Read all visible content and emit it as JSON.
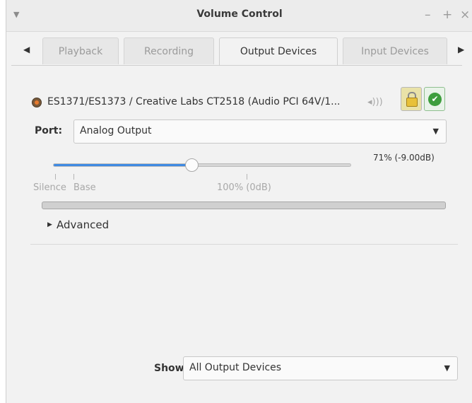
{
  "window": {
    "title": "Volume Control",
    "controls": [
      "minimize-icon",
      "maximize-icon",
      "close-icon"
    ]
  },
  "tabs": [
    {
      "label": "Playback",
      "active": false
    },
    {
      "label": "Recording",
      "active": false
    },
    {
      "label": "Output Devices",
      "active": true
    },
    {
      "label": "Input Devices",
      "active": false
    }
  ],
  "device": {
    "name": "ES1371/ES1373 / Creative Labs CT2518 (Audio PCI 64V/1...",
    "mute_icon": "speaker-icon",
    "lock_icon": "padlock-icon",
    "default_icon": "checkmark-icon",
    "port_label": "Port:",
    "port_value": "Analog Output",
    "volume_text": "71% (-9.00dB)",
    "volume_fraction": 0.71,
    "scale_marks": [
      "Silence",
      "Base",
      "100% (0dB)"
    ],
    "advanced_label": "Advanced"
  },
  "footer": {
    "show_label": "Show:",
    "show_value": "All Output Devices"
  },
  "colors": {
    "accent": "#3f8ae2",
    "window_bg": "#f2f2f2"
  }
}
